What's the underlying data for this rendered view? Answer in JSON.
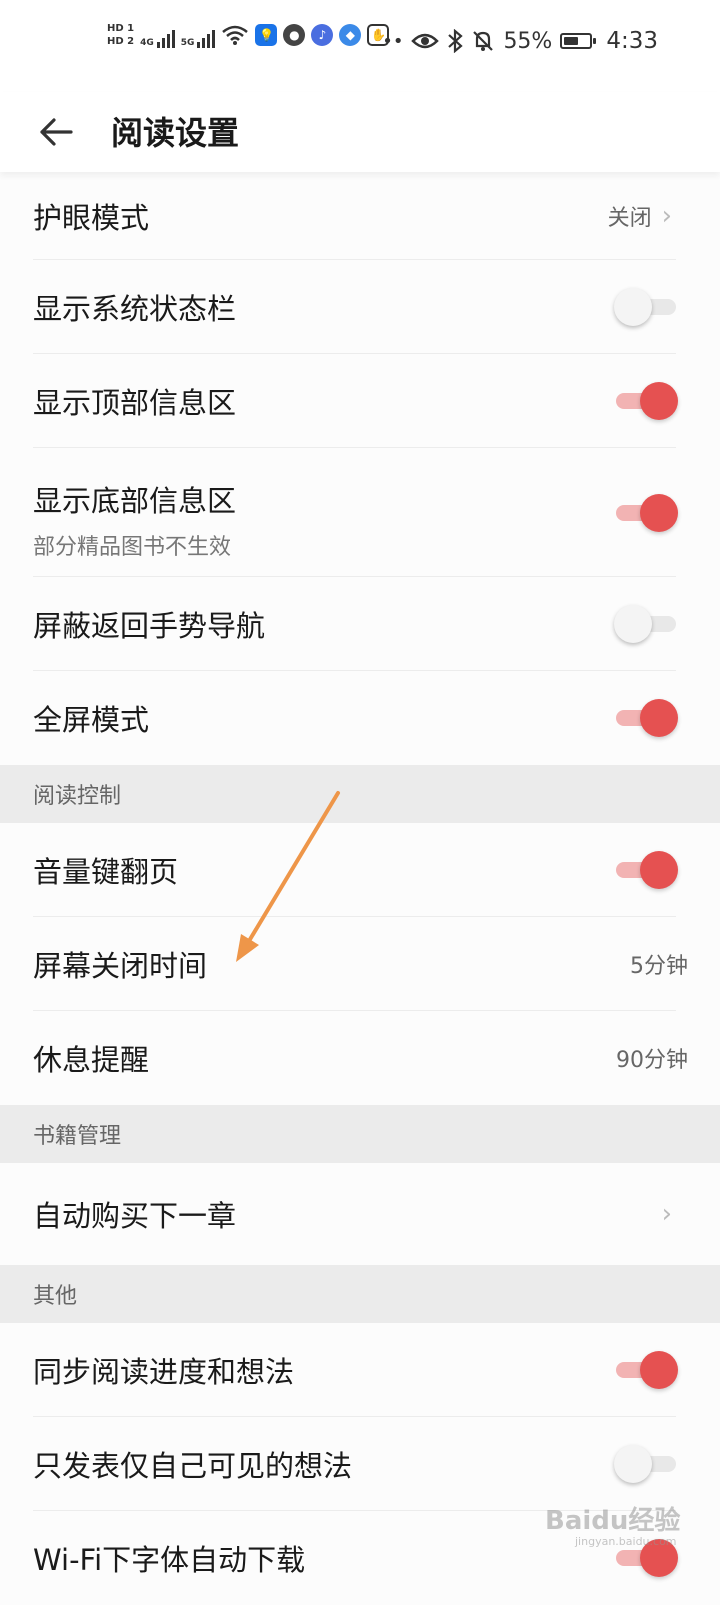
{
  "status_bar": {
    "sim1": "HD 1",
    "sim2": "HD 2",
    "net1": "4G",
    "net2": "5G",
    "battery_percent": "55%",
    "battery_level": 0.55,
    "time": "4:33"
  },
  "header": {
    "title": "阅读设置"
  },
  "rows": {
    "eye_mode": {
      "label": "护眼模式",
      "value": "关闭"
    },
    "show_status_bar": {
      "label": "显示系统状态栏",
      "on": false
    },
    "show_top_info": {
      "label": "显示顶部信息区",
      "on": true
    },
    "show_bottom_info": {
      "label": "显示底部信息区",
      "sublabel": "部分精品图书不生效",
      "on": true
    },
    "block_back_gesture": {
      "label": "屏蔽返回手势导航",
      "on": false
    },
    "fullscreen": {
      "label": "全屏模式",
      "on": true
    },
    "volume_key_page": {
      "label": "音量键翻页",
      "on": true
    },
    "screen_off_time": {
      "label": "屏幕关闭时间",
      "value": "5分钟"
    },
    "rest_reminder": {
      "label": "休息提醒",
      "value": "90分钟"
    },
    "auto_buy_next": {
      "label": "自动购买下一章"
    },
    "sync_progress": {
      "label": "同步阅读进度和想法",
      "on": true
    },
    "private_thoughts": {
      "label": "只发表仅自己可见的想法",
      "on": false
    },
    "wifi_font_download": {
      "label": "Wi-Fi下字体自动下载",
      "on": true
    }
  },
  "sections": {
    "reading_control": "阅读控制",
    "book_management": "书籍管理",
    "other": "其他"
  },
  "watermark": {
    "text": "Baidu经验",
    "url": "jingyan.baidu.com"
  },
  "colors": {
    "accent": "#e55151",
    "track_on": "#f2b3b3",
    "section_bg": "#ebebeb",
    "arrow": "#ee9649"
  }
}
